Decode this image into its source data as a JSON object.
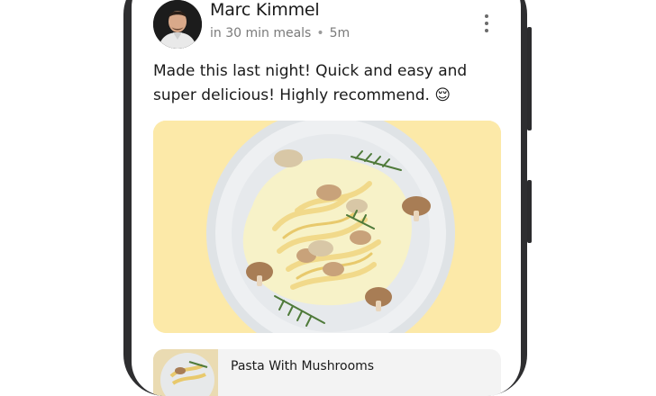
{
  "post": {
    "author_name": "Marc Kimmel",
    "group": "in 30 min meals",
    "separator": "•",
    "time_ago": "5m",
    "text": "Made this last night! Quick and easy and super delicious! Highly recommend. 😌"
  },
  "recipe": {
    "title": "Pasta With Mushrooms"
  },
  "icons": {
    "more": "more-vertical-icon"
  },
  "colors": {
    "card_background": "#fce9a8",
    "phone_frame": "#2e2e30",
    "meta_text": "#7a7a7a"
  }
}
